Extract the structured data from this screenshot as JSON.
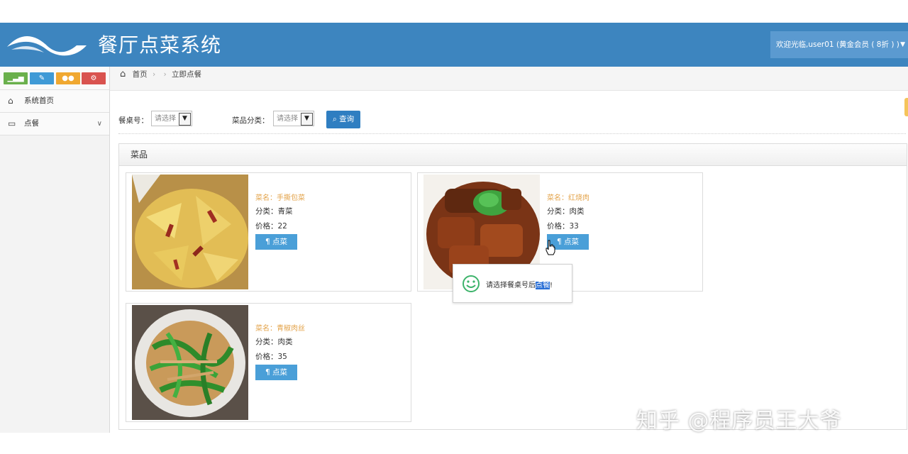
{
  "header": {
    "app_title": "餐厅点菜系统",
    "welcome": "欢迎光临,user01 (黄金会员 ( 8折 ) )"
  },
  "sidebar": {
    "items": [
      {
        "label": "系统首页",
        "icon": "home-icon"
      },
      {
        "label": "点餐",
        "icon": "card-icon"
      }
    ]
  },
  "breadcrumb": {
    "home": "首页",
    "current": "立即点餐"
  },
  "filters": {
    "table_label": "餐桌号：",
    "table_value": "请选择",
    "category_label": "菜品分类：",
    "category_value": "请选择",
    "query_label": "查询"
  },
  "panel": {
    "title": "菜品"
  },
  "dishes": [
    {
      "name": "菜名：手撕包菜",
      "category": "分类：青菜",
      "price": "价格：22",
      "button": "点菜"
    },
    {
      "name": "菜名：红烧肉",
      "category": "分类：肉类",
      "price": "价格：33",
      "button": "点菜"
    },
    {
      "name": "菜名：青椒肉丝",
      "category": "分类：肉类",
      "price": "价格：35",
      "button": "点菜"
    }
  ],
  "toast": {
    "before": "请选择餐桌号后",
    "highlight": "点餐",
    "after": "!"
  },
  "watermark": "知乎 @程序员王大爷",
  "colors": {
    "header": "#3d85bf",
    "button": "#2f7ec1",
    "accent": "#e3a34a"
  }
}
